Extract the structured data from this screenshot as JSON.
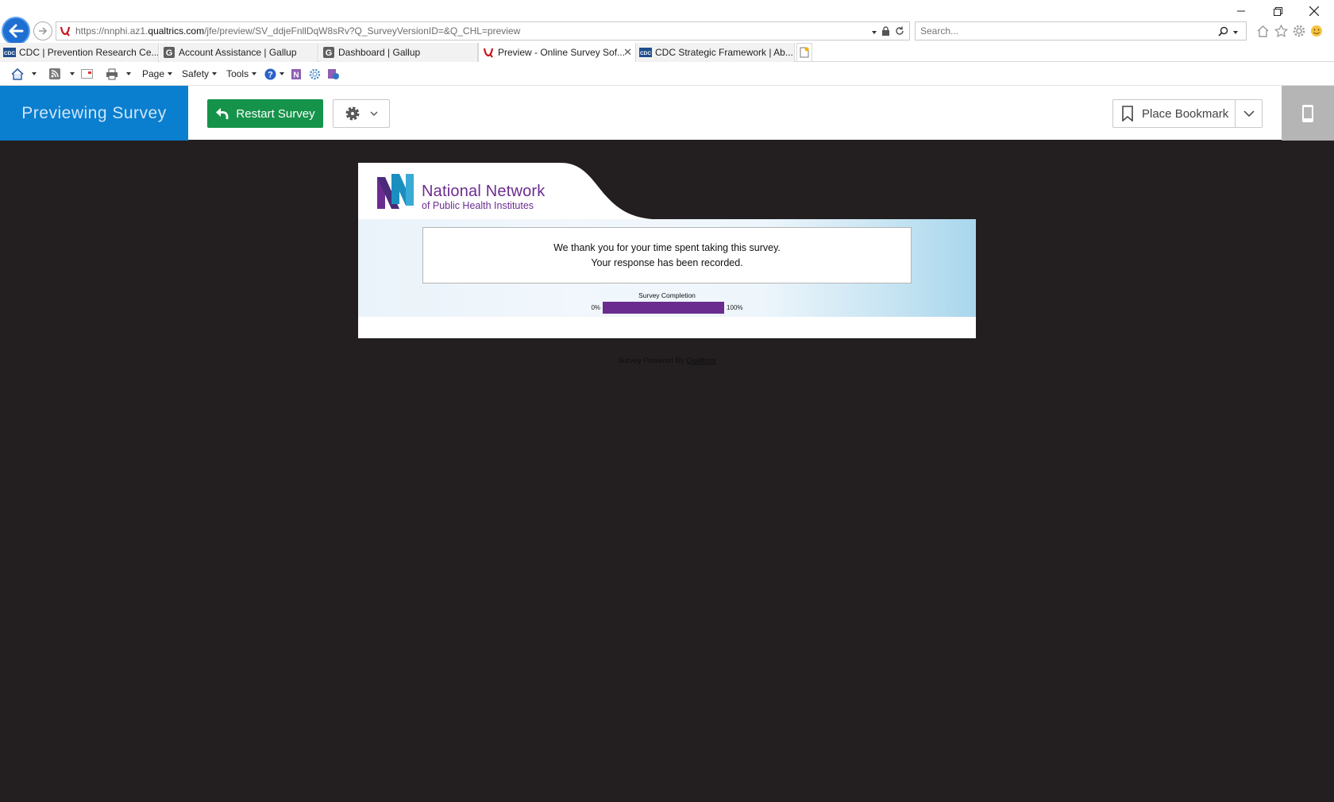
{
  "browser": {
    "url_prefix": "https://nnphi.az1.",
    "url_domain": "qualtrics.com",
    "url_path": "/jfe/preview/SV_ddjeFnllDqW8sRv?Q_SurveyVersionID=&Q_CHL=preview",
    "search_placeholder": "Search...",
    "tabs": [
      {
        "label": "CDC | Prevention Research Ce...",
        "favicon": "cdc-icon",
        "active": false
      },
      {
        "label": "Account Assistance | Gallup",
        "favicon": "gallup-icon",
        "active": false
      },
      {
        "label": "Dashboard | Gallup",
        "favicon": "gallup-icon",
        "active": false
      },
      {
        "label": "Preview - Online Survey Sof...",
        "favicon": "qualtrics-icon",
        "active": true
      },
      {
        "label": "CDC Strategic Framework | Ab...",
        "favicon": "cdc-icon",
        "active": false
      }
    ],
    "command_bar": {
      "page": "Page",
      "safety": "Safety",
      "tools": "Tools"
    }
  },
  "preview_bar": {
    "title": "Previewing Survey",
    "restart_label": "Restart Survey",
    "bookmark_label": "Place Bookmark"
  },
  "survey": {
    "logo_line1": "National Network",
    "logo_line2": "of Public Health Institutes",
    "message_line1": "We thank you for your time spent taking this survey.",
    "message_line2": "Your response has been recorded.",
    "progress_label": "Survey Completion",
    "progress_min": "0%",
    "progress_max": "100%",
    "progress_fraction": 1.0,
    "footer_text": "Survey Powered By",
    "footer_link": "Qualtrics"
  },
  "colors": {
    "brand_purple": "#6b2c8f",
    "brand_teal": "#1a8fbf",
    "preview_blue": "#0a7ecf",
    "restart_green": "#15934a",
    "page_bg": "#231f20"
  }
}
